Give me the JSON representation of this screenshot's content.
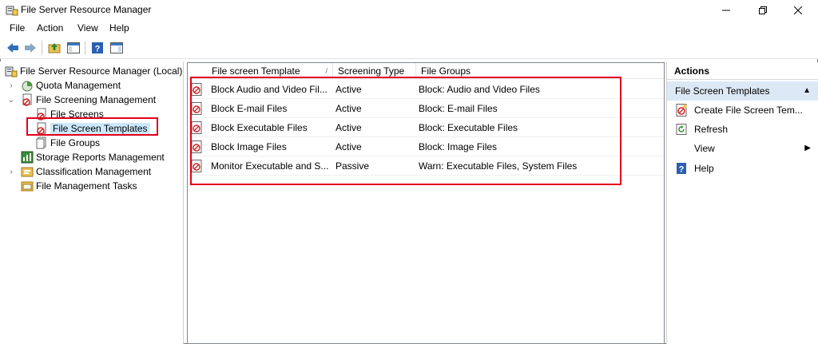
{
  "window": {
    "title": "File Server Resource Manager"
  },
  "menu": [
    "File",
    "Action",
    "View",
    "Help"
  ],
  "tree": {
    "root": "File Server Resource Manager (Local)",
    "quota": "Quota Management",
    "screening": "File Screening Management",
    "file_screens": "File Screens",
    "file_screen_templates": "File Screen Templates",
    "file_groups": "File Groups",
    "storage_reports": "Storage Reports Management",
    "classification": "Classification Management",
    "file_management_tasks": "File Management Tasks"
  },
  "list": {
    "columns": [
      "File screen Template",
      "Screening Type",
      "File Groups"
    ],
    "rows": [
      {
        "template": "Block Audio and Video Fil...",
        "type": "Active",
        "groups": "Block: Audio and Video Files"
      },
      {
        "template": "Block E-mail Files",
        "type": "Active",
        "groups": "Block: E-mail Files"
      },
      {
        "template": "Block Executable Files",
        "type": "Active",
        "groups": "Block: Executable Files"
      },
      {
        "template": "Block Image Files",
        "type": "Active",
        "groups": "Block: Image Files"
      },
      {
        "template": "Monitor Executable and S...",
        "type": "Passive",
        "groups": "Warn: Executable Files, System Files"
      }
    ]
  },
  "actions": {
    "title": "Actions",
    "section": "File Screen Templates",
    "items": [
      "Create File Screen Tem...",
      "Refresh",
      "View",
      "Help"
    ]
  },
  "colors": {
    "highlight": "#e3001b",
    "selection": "#cce8ff",
    "section_bg": "#dce8f5"
  }
}
